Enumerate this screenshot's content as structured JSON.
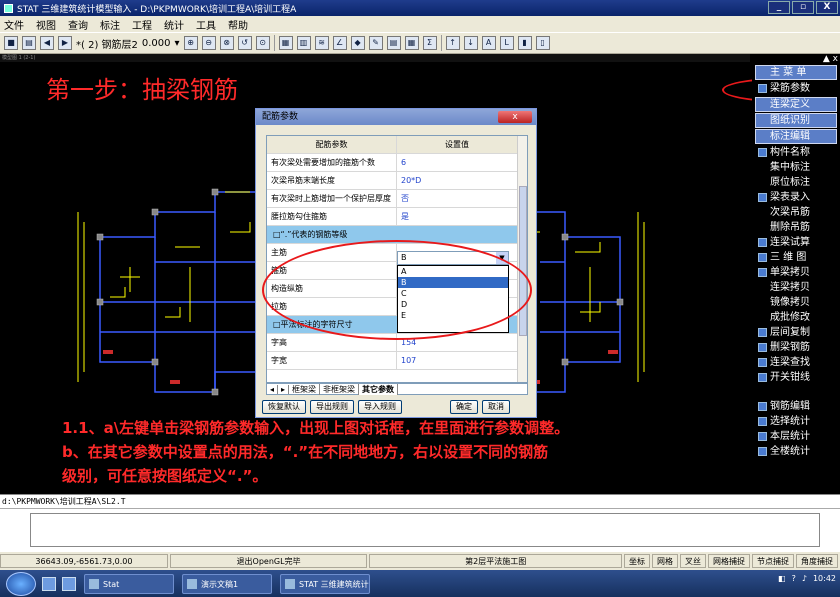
{
  "window": {
    "title": "STAT 三维建筑统计模型输入 - D:\\PKPMWORK\\培训工程A\\培训工程A",
    "minimize": "_",
    "maximize": "▫",
    "close": "X"
  },
  "menu": [
    "文件",
    "视图",
    "查询",
    "标注",
    "工程",
    "统计",
    "工具",
    "帮助"
  ],
  "toolbar": {
    "layer_selector": "*( 2) 钢筋层2",
    "elevation": "0.000"
  },
  "canvas": {
    "tab_label": "模型图 1 (2-1)",
    "step_title": "第一步：抽梁钢筋",
    "note_lines": [
      "1.1、a\\左键单击梁钢筋参数输入，出现上图对话框，在里面进行参数调整。",
      "b、在其它参数中设置点的用法，“.”在不同地地方，右以设置不同的钢筋",
      "级别，可任意按图纸定义“.”。"
    ]
  },
  "dialog": {
    "title": "配筋参数",
    "close_label": "x",
    "headers": {
      "param": "配筋参数",
      "value": "设置值"
    },
    "rows": [
      {
        "param": "有次梁处需要增加的箍筋个数",
        "value": "6"
      },
      {
        "param": "次梁吊筋末端长度",
        "value": "20*D"
      },
      {
        "param": "有次梁时上筋增加一个保护层厚度",
        "value": "否"
      },
      {
        "param": "腰拉筋勾住箍筋",
        "value": "是"
      }
    ],
    "group1": "□“.”代表的钢筋等级",
    "grade_rows": [
      {
        "param": "主筋",
        "value": "B"
      },
      {
        "param": "箍筋",
        "value": ""
      },
      {
        "param": "构造纵筋",
        "value": ""
      },
      {
        "param": "拉筋",
        "value": ""
      }
    ],
    "group2": "□平法标注的字符尺寸",
    "size_rows": [
      {
        "param": "字高",
        "value": "154"
      },
      {
        "param": "字宽",
        "value": "107"
      }
    ],
    "dropdown_value": "B",
    "dropdown_options": [
      "A",
      "B",
      "C",
      "D",
      "E"
    ],
    "dropdown_selected": "B",
    "tabs": [
      "框架梁",
      "非框架梁",
      "其它参数"
    ],
    "buttons": {
      "restore": "恢复默认",
      "export": "导出规则",
      "import": "导入规则",
      "ok": "确定",
      "cancel": "取消"
    }
  },
  "right_panel": {
    "main_menu": "主 菜 单",
    "items_top": [
      {
        "label": "梁筋参数",
        "type": "item"
      },
      {
        "label": "连梁定义",
        "type": "head"
      },
      {
        "label": "图纸识别",
        "type": "head"
      },
      {
        "label": "标注编辑",
        "type": "head"
      }
    ],
    "items": [
      "构件名称",
      "集中标注",
      "原位标注",
      "梁表录入",
      "次梁吊筋",
      "删除吊筋",
      "连梁试算",
      "三 维 图",
      "单梁拷贝",
      "连梁拷贝",
      "镜像拷贝",
      "成批修改",
      "层间复制",
      "删梁钢筋",
      "连梁查找",
      "开关钳线"
    ],
    "items_bottom": [
      "钢筋编辑",
      "选择统计",
      "本层统计",
      "全楼统计"
    ]
  },
  "path_line": "d:\\PKPMWORK\\培训工程A\\SL2.T",
  "status": {
    "coords": "36643.09,-6561.73,0.00",
    "message": "退出OpenGL完毕",
    "drawing": "第2层平法施工图",
    "modes": [
      "坐标",
      "网格",
      "叉丝",
      "网格捕捉",
      "节点捕捉",
      "角度捕捉"
    ]
  },
  "taskbar": {
    "tasks": [
      "Stat",
      "演示文稿1",
      "STAT 三维建筑统计..."
    ],
    "clock": "10:42"
  },
  "colors": {
    "annotation_red": "#ff2a2a",
    "cad_yellow": "#ffff00",
    "cad_blue": "#3a5bff",
    "grid_group": "#8fc8ec"
  }
}
